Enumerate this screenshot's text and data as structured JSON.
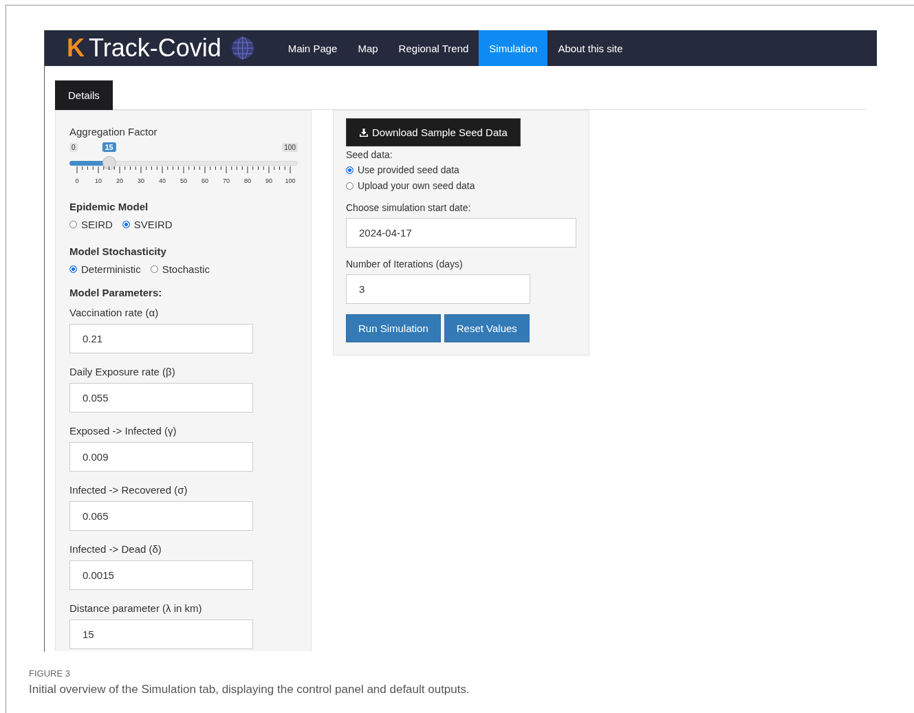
{
  "navbar": {
    "logo": {
      "mark": "K",
      "title": "Track-Covid"
    },
    "items": [
      {
        "label": "Main Page",
        "selected": false
      },
      {
        "label": "Map",
        "selected": false
      },
      {
        "label": "Regional Trend",
        "selected": false
      },
      {
        "label": "Simulation",
        "selected": true
      },
      {
        "label": "About this site",
        "selected": false
      }
    ]
  },
  "tabs": [
    {
      "label": "Details",
      "selected": true
    }
  ],
  "controls": {
    "aggregation": {
      "label": "Aggregation Factor",
      "min": "0",
      "max": "100",
      "value": "15",
      "level": 0.15,
      "ticks": [
        "0",
        "10",
        "20",
        "30",
        "40",
        "50",
        "60",
        "70",
        "80",
        "90",
        "100"
      ]
    },
    "epidemic_model": {
      "title": "Epidemic Model",
      "options": [
        {
          "label": "SEIRD",
          "selected": false
        },
        {
          "label": "SVEIRD",
          "selected": true
        }
      ]
    },
    "stochasticity": {
      "title": "Model Stochasticity",
      "options": [
        {
          "label": "Deterministic",
          "selected": true
        },
        {
          "label": "Stochastic",
          "selected": false
        }
      ]
    },
    "parameters": {
      "title": "Model Parameters:",
      "fields": [
        {
          "label": "Vaccination rate (α)",
          "value": "0.21"
        },
        {
          "label": "Daily Exposure rate (β)",
          "value": "0.055"
        },
        {
          "label": "Exposed -> Infected (γ)",
          "value": "0.009"
        },
        {
          "label": "Infected -> Recovered (σ)",
          "value": "0.065"
        },
        {
          "label": "Infected -> Dead (δ)",
          "value": "0.0015"
        },
        {
          "label": "Distance parameter (λ in km)",
          "value": "15"
        }
      ]
    }
  },
  "seed_panel": {
    "download_button": "Download Sample Seed Data",
    "seed_label": "Seed data:",
    "seed_options": [
      {
        "label": "Use provided seed data",
        "selected": true
      },
      {
        "label": "Upload your own seed data",
        "selected": false
      }
    ],
    "start_date": {
      "label": "Choose simulation start date:",
      "value": "2024-04-17"
    },
    "iterations": {
      "label": "Number of Iterations (days)",
      "value": "3"
    },
    "buttons": [
      "Run Simulation",
      "Reset Values"
    ]
  },
  "caption": {
    "label": "FIGURE 3",
    "text": "Initial overview of the Simulation tab, displaying the control panel and default outputs."
  }
}
